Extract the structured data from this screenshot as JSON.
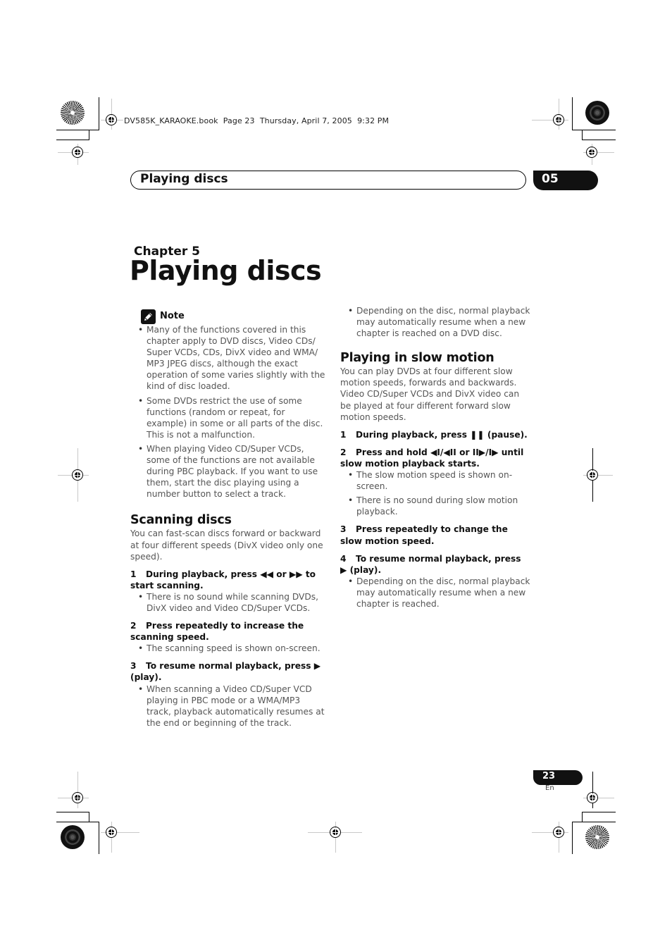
{
  "slug": {
    "text": "DV585K_KARAOKE.book  Page 23  Thursday, April 7, 2005  9:32 PM"
  },
  "header": {
    "section_title": "Playing discs",
    "chapter_number": "05"
  },
  "chapter": {
    "label": "Chapter 5",
    "title": "Playing discs"
  },
  "note": {
    "icon": "pencil-note-icon",
    "label": "Note",
    "items": [
      "Many of the functions covered in this chapter apply to DVD discs, Video CDs/ Super VCDs, CDs, DivX video and WMA/ MP3 JPEG discs, although the exact operation of some varies slightly with the kind of disc loaded.",
      "Some DVDs restrict the use of some functions (random or repeat, for example) in some or all parts of the disc. This is not a malfunction.",
      "When playing Video CD/Super VCDs, some of the functions are not available during PBC playback. If you want to use them, start the disc playing using a number button to select a track."
    ]
  },
  "scanning": {
    "heading": "Scanning discs",
    "intro": "You can fast-scan discs forward or backward at four different speeds (DivX video only one speed).",
    "steps": [
      {
        "num": "1",
        "text": "During playback, press ◀◀ or ▶▶ to start scanning.",
        "bullets": [
          "There is no sound while scanning DVDs, DivX video and Video CD/Super VCDs."
        ]
      },
      {
        "num": "2",
        "text": "Press repeatedly to increase the scanning speed.",
        "bullets": [
          "The scanning speed is shown on-screen."
        ]
      },
      {
        "num": "3",
        "text": "To resume normal playback, press ▶ (play).",
        "bullets": [
          "When scanning a Video CD/Super VCD playing in PBC mode or a WMA/MP3 track, playback automatically resumes at the end or beginning of the track."
        ]
      }
    ]
  },
  "scanning_continued": {
    "bullets": [
      "Depending on the disc, normal playback may automatically resume when a new chapter is reached on a DVD disc."
    ]
  },
  "slow_motion": {
    "heading": "Playing in slow motion",
    "intro": "You can play DVDs at four different slow motion speeds, forwards and backwards. Video CD/Super VCDs and DivX video can be played at four different forward slow motion speeds.",
    "steps": [
      {
        "num": "1",
        "text": "During playback, press ❚❚ (pause).",
        "bullets": []
      },
      {
        "num": "2",
        "text": "Press and hold ◀I/◀II or II▶/I▶ until slow motion playback starts.",
        "bullets": [
          "The slow motion speed is shown on-screen.",
          "There is no sound during slow motion playback."
        ]
      },
      {
        "num": "3",
        "text": "Press repeatedly to change the slow motion speed.",
        "bullets": []
      },
      {
        "num": "4",
        "text": "To resume normal playback, press ▶ (play).",
        "bullets": [
          "Depending on the disc, normal playback may automatically resume when a new chapter is reached."
        ]
      }
    ]
  },
  "footer": {
    "page_number": "23",
    "language": "En"
  }
}
